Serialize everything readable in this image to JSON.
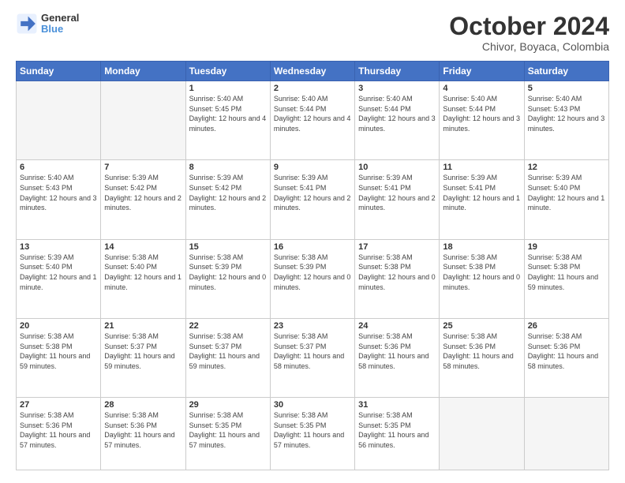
{
  "logo": {
    "line1": "General",
    "line2": "Blue"
  },
  "title": "October 2024",
  "subtitle": "Chivor, Boyaca, Colombia",
  "headers": [
    "Sunday",
    "Monday",
    "Tuesday",
    "Wednesday",
    "Thursday",
    "Friday",
    "Saturday"
  ],
  "weeks": [
    [
      {
        "day": "",
        "sunrise": "",
        "sunset": "",
        "daylight": ""
      },
      {
        "day": "",
        "sunrise": "",
        "sunset": "",
        "daylight": ""
      },
      {
        "day": "1",
        "sunrise": "Sunrise: 5:40 AM",
        "sunset": "Sunset: 5:45 PM",
        "daylight": "Daylight: 12 hours and 4 minutes."
      },
      {
        "day": "2",
        "sunrise": "Sunrise: 5:40 AM",
        "sunset": "Sunset: 5:44 PM",
        "daylight": "Daylight: 12 hours and 4 minutes."
      },
      {
        "day": "3",
        "sunrise": "Sunrise: 5:40 AM",
        "sunset": "Sunset: 5:44 PM",
        "daylight": "Daylight: 12 hours and 3 minutes."
      },
      {
        "day": "4",
        "sunrise": "Sunrise: 5:40 AM",
        "sunset": "Sunset: 5:44 PM",
        "daylight": "Daylight: 12 hours and 3 minutes."
      },
      {
        "day": "5",
        "sunrise": "Sunrise: 5:40 AM",
        "sunset": "Sunset: 5:43 PM",
        "daylight": "Daylight: 12 hours and 3 minutes."
      }
    ],
    [
      {
        "day": "6",
        "sunrise": "Sunrise: 5:40 AM",
        "sunset": "Sunset: 5:43 PM",
        "daylight": "Daylight: 12 hours and 3 minutes."
      },
      {
        "day": "7",
        "sunrise": "Sunrise: 5:39 AM",
        "sunset": "Sunset: 5:42 PM",
        "daylight": "Daylight: 12 hours and 2 minutes."
      },
      {
        "day": "8",
        "sunrise": "Sunrise: 5:39 AM",
        "sunset": "Sunset: 5:42 PM",
        "daylight": "Daylight: 12 hours and 2 minutes."
      },
      {
        "day": "9",
        "sunrise": "Sunrise: 5:39 AM",
        "sunset": "Sunset: 5:41 PM",
        "daylight": "Daylight: 12 hours and 2 minutes."
      },
      {
        "day": "10",
        "sunrise": "Sunrise: 5:39 AM",
        "sunset": "Sunset: 5:41 PM",
        "daylight": "Daylight: 12 hours and 2 minutes."
      },
      {
        "day": "11",
        "sunrise": "Sunrise: 5:39 AM",
        "sunset": "Sunset: 5:41 PM",
        "daylight": "Daylight: 12 hours and 1 minute."
      },
      {
        "day": "12",
        "sunrise": "Sunrise: 5:39 AM",
        "sunset": "Sunset: 5:40 PM",
        "daylight": "Daylight: 12 hours and 1 minute."
      }
    ],
    [
      {
        "day": "13",
        "sunrise": "Sunrise: 5:39 AM",
        "sunset": "Sunset: 5:40 PM",
        "daylight": "Daylight: 12 hours and 1 minute."
      },
      {
        "day": "14",
        "sunrise": "Sunrise: 5:38 AM",
        "sunset": "Sunset: 5:40 PM",
        "daylight": "Daylight: 12 hours and 1 minute."
      },
      {
        "day": "15",
        "sunrise": "Sunrise: 5:38 AM",
        "sunset": "Sunset: 5:39 PM",
        "daylight": "Daylight: 12 hours and 0 minutes."
      },
      {
        "day": "16",
        "sunrise": "Sunrise: 5:38 AM",
        "sunset": "Sunset: 5:39 PM",
        "daylight": "Daylight: 12 hours and 0 minutes."
      },
      {
        "day": "17",
        "sunrise": "Sunrise: 5:38 AM",
        "sunset": "Sunset: 5:38 PM",
        "daylight": "Daylight: 12 hours and 0 minutes."
      },
      {
        "day": "18",
        "sunrise": "Sunrise: 5:38 AM",
        "sunset": "Sunset: 5:38 PM",
        "daylight": "Daylight: 12 hours and 0 minutes."
      },
      {
        "day": "19",
        "sunrise": "Sunrise: 5:38 AM",
        "sunset": "Sunset: 5:38 PM",
        "daylight": "Daylight: 11 hours and 59 minutes."
      }
    ],
    [
      {
        "day": "20",
        "sunrise": "Sunrise: 5:38 AM",
        "sunset": "Sunset: 5:38 PM",
        "daylight": "Daylight: 11 hours and 59 minutes."
      },
      {
        "day": "21",
        "sunrise": "Sunrise: 5:38 AM",
        "sunset": "Sunset: 5:37 PM",
        "daylight": "Daylight: 11 hours and 59 minutes."
      },
      {
        "day": "22",
        "sunrise": "Sunrise: 5:38 AM",
        "sunset": "Sunset: 5:37 PM",
        "daylight": "Daylight: 11 hours and 59 minutes."
      },
      {
        "day": "23",
        "sunrise": "Sunrise: 5:38 AM",
        "sunset": "Sunset: 5:37 PM",
        "daylight": "Daylight: 11 hours and 58 minutes."
      },
      {
        "day": "24",
        "sunrise": "Sunrise: 5:38 AM",
        "sunset": "Sunset: 5:36 PM",
        "daylight": "Daylight: 11 hours and 58 minutes."
      },
      {
        "day": "25",
        "sunrise": "Sunrise: 5:38 AM",
        "sunset": "Sunset: 5:36 PM",
        "daylight": "Daylight: 11 hours and 58 minutes."
      },
      {
        "day": "26",
        "sunrise": "Sunrise: 5:38 AM",
        "sunset": "Sunset: 5:36 PM",
        "daylight": "Daylight: 11 hours and 58 minutes."
      }
    ],
    [
      {
        "day": "27",
        "sunrise": "Sunrise: 5:38 AM",
        "sunset": "Sunset: 5:36 PM",
        "daylight": "Daylight: 11 hours and 57 minutes."
      },
      {
        "day": "28",
        "sunrise": "Sunrise: 5:38 AM",
        "sunset": "Sunset: 5:36 PM",
        "daylight": "Daylight: 11 hours and 57 minutes."
      },
      {
        "day": "29",
        "sunrise": "Sunrise: 5:38 AM",
        "sunset": "Sunset: 5:35 PM",
        "daylight": "Daylight: 11 hours and 57 minutes."
      },
      {
        "day": "30",
        "sunrise": "Sunrise: 5:38 AM",
        "sunset": "Sunset: 5:35 PM",
        "daylight": "Daylight: 11 hours and 57 minutes."
      },
      {
        "day": "31",
        "sunrise": "Sunrise: 5:38 AM",
        "sunset": "Sunset: 5:35 PM",
        "daylight": "Daylight: 11 hours and 56 minutes."
      },
      {
        "day": "",
        "sunrise": "",
        "sunset": "",
        "daylight": ""
      },
      {
        "day": "",
        "sunrise": "",
        "sunset": "",
        "daylight": ""
      }
    ]
  ]
}
